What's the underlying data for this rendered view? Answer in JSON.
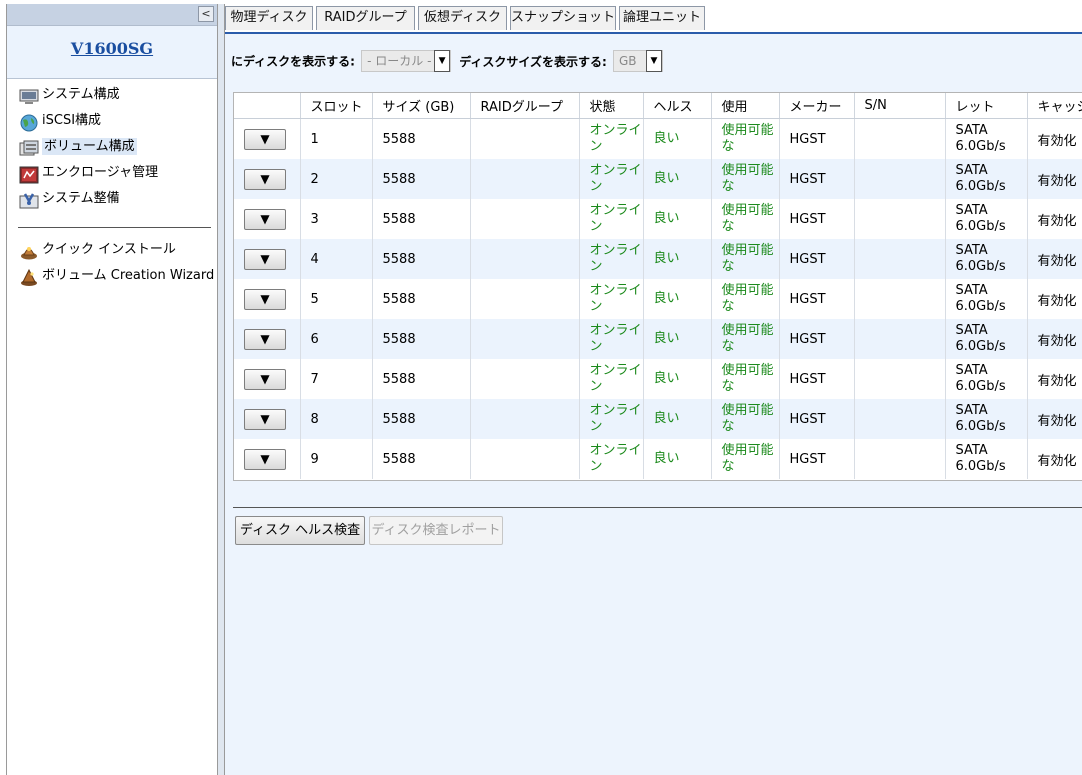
{
  "sidebar": {
    "collapse_glyph": "<",
    "title": "V1600SG",
    "main_items": [
      {
        "label": "システム構成",
        "icon": "system-config-icon"
      },
      {
        "label": "iSCSI構成",
        "icon": "iscsi-globe-icon"
      },
      {
        "label": "ボリューム構成",
        "icon": "volume-config-icon",
        "active": true
      },
      {
        "label": "エンクロージャ管理",
        "icon": "enclosure-icon"
      },
      {
        "label": "システム整備",
        "icon": "maintenance-icon"
      }
    ],
    "tool_items": [
      {
        "label": "クイック インストール",
        "icon": "quick-install-icon"
      },
      {
        "label": "ボリューム Creation Wizard",
        "icon": "wizard-icon"
      }
    ]
  },
  "tabs": [
    {
      "label": "物理ディスク",
      "active": true
    },
    {
      "label": "RAIDグループ"
    },
    {
      "label": "仮想ディスク"
    },
    {
      "label": "スナップショット"
    },
    {
      "label": "論理ユニット"
    }
  ],
  "filters": {
    "disk_label": "にディスクを表示する:",
    "disk_value": "- ローカル -",
    "size_label": "ディスクサイズを表示する:",
    "size_value": "GB",
    "arrow": "▼"
  },
  "table": {
    "headers": [
      "",
      "スロット",
      "サイズ (GB)",
      "RAIDグループ",
      "状態",
      "ヘルス",
      "使用",
      "メーカー",
      "S/N",
      "レット",
      "キャッシュ"
    ],
    "action_glyph": "▼",
    "rows": [
      {
        "slot": "1",
        "size": "5588",
        "raid": "",
        "status": "オンライン",
        "health": "良い",
        "usage": "使用可能な",
        "vendor": "HGST",
        "sn": "",
        "rate": "SATA 6.0Gb/s",
        "cache": "有効化"
      },
      {
        "slot": "2",
        "size": "5588",
        "raid": "",
        "status": "オンライン",
        "health": "良い",
        "usage": "使用可能な",
        "vendor": "HGST",
        "sn": "",
        "rate": "SATA 6.0Gb/s",
        "cache": "有効化"
      },
      {
        "slot": "3",
        "size": "5588",
        "raid": "",
        "status": "オンライン",
        "health": "良い",
        "usage": "使用可能な",
        "vendor": "HGST",
        "sn": "",
        "rate": "SATA 6.0Gb/s",
        "cache": "有効化"
      },
      {
        "slot": "4",
        "size": "5588",
        "raid": "",
        "status": "オンライン",
        "health": "良い",
        "usage": "使用可能な",
        "vendor": "HGST",
        "sn": "",
        "rate": "SATA 6.0Gb/s",
        "cache": "有効化"
      },
      {
        "slot": "5",
        "size": "5588",
        "raid": "",
        "status": "オンライン",
        "health": "良い",
        "usage": "使用可能な",
        "vendor": "HGST",
        "sn": "",
        "rate": "SATA 6.0Gb/s",
        "cache": "有効化"
      },
      {
        "slot": "6",
        "size": "5588",
        "raid": "",
        "status": "オンライン",
        "health": "良い",
        "usage": "使用可能な",
        "vendor": "HGST",
        "sn": "",
        "rate": "SATA 6.0Gb/s",
        "cache": "有効化"
      },
      {
        "slot": "7",
        "size": "5588",
        "raid": "",
        "status": "オンライン",
        "health": "良い",
        "usage": "使用可能な",
        "vendor": "HGST",
        "sn": "",
        "rate": "SATA 6.0Gb/s",
        "cache": "有効化"
      },
      {
        "slot": "8",
        "size": "5588",
        "raid": "",
        "status": "オンライン",
        "health": "良い",
        "usage": "使用可能な",
        "vendor": "HGST",
        "sn": "",
        "rate": "SATA 6.0Gb/s",
        "cache": "有効化"
      },
      {
        "slot": "9",
        "size": "5588",
        "raid": "",
        "status": "オンライン",
        "health": "良い",
        "usage": "使用可能な",
        "vendor": "HGST",
        "sn": "",
        "rate": "SATA 6.0Gb/s",
        "cache": "有効化"
      }
    ]
  },
  "buttons": {
    "health_check": "ディスク ヘルス検査",
    "check_report": "ディスク検査レポート"
  },
  "colors": {
    "accent": "#2f63b4",
    "status_ok": "#1c8a1c",
    "panel_bg": "#edf4fd",
    "row_alt": "#ebf3fd"
  }
}
